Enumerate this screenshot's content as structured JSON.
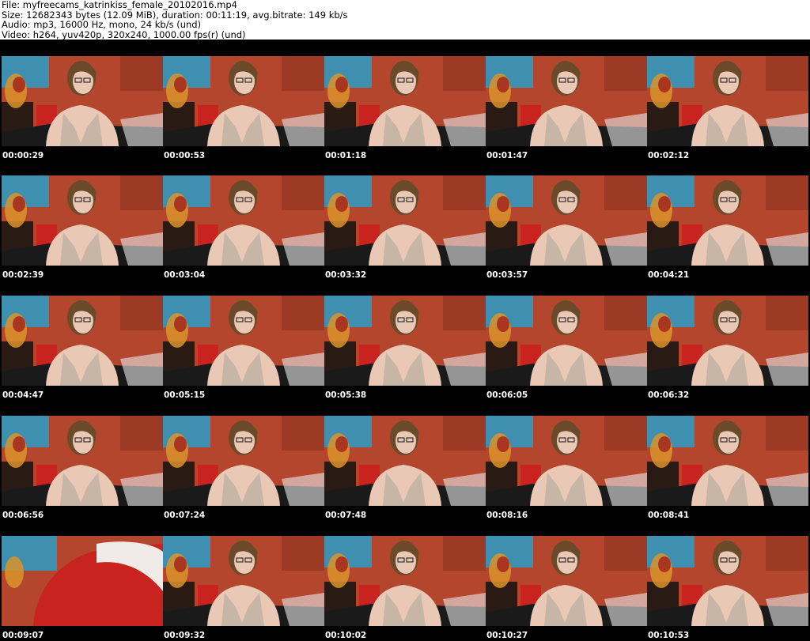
{
  "header": {
    "file_line": "File: myfreecams_katrinkiss_female_20102016.mp4",
    "size_line": "Size: 12682343 bytes (12.09 MiB), duration: 00:11:19, avg.bitrate: 149 kb/s",
    "audio_line": "Audio: mp3, 16000 Hz, mono, 24 kb/s (und)",
    "video_line": "Video: h264, yuv420p, 320x240, 1000.00 fps(r) (und)"
  },
  "thumbnails": [
    {
      "timestamp": "00:00:29",
      "variant": "normal"
    },
    {
      "timestamp": "00:00:53",
      "variant": "normal"
    },
    {
      "timestamp": "00:01:18",
      "variant": "normal"
    },
    {
      "timestamp": "00:01:47",
      "variant": "normal"
    },
    {
      "timestamp": "00:02:12",
      "variant": "normal"
    },
    {
      "timestamp": "00:02:39",
      "variant": "normal"
    },
    {
      "timestamp": "00:03:04",
      "variant": "normal"
    },
    {
      "timestamp": "00:03:32",
      "variant": "normal"
    },
    {
      "timestamp": "00:03:57",
      "variant": "normal"
    },
    {
      "timestamp": "00:04:21",
      "variant": "normal"
    },
    {
      "timestamp": "00:04:47",
      "variant": "normal"
    },
    {
      "timestamp": "00:05:15",
      "variant": "normal"
    },
    {
      "timestamp": "00:05:38",
      "variant": "normal"
    },
    {
      "timestamp": "00:06:05",
      "variant": "normal"
    },
    {
      "timestamp": "00:06:32",
      "variant": "normal"
    },
    {
      "timestamp": "00:06:56",
      "variant": "normal"
    },
    {
      "timestamp": "00:07:24",
      "variant": "normal"
    },
    {
      "timestamp": "00:07:48",
      "variant": "normal"
    },
    {
      "timestamp": "00:08:16",
      "variant": "normal"
    },
    {
      "timestamp": "00:08:41",
      "variant": "normal"
    },
    {
      "timestamp": "00:09:07",
      "variant": "closeup"
    },
    {
      "timestamp": "00:09:32",
      "variant": "normal"
    },
    {
      "timestamp": "00:10:02",
      "variant": "normal"
    },
    {
      "timestamp": "00:10:27",
      "variant": "normal"
    },
    {
      "timestamp": "00:10:53",
      "variant": "normal"
    }
  ],
  "colors": {
    "background_wall": "#b4462e",
    "poster_blue": "#3f8fb0",
    "curtain_red": "#c8231e",
    "top_garment": "#c7b5a6",
    "skin": "#e9c9b6",
    "hair": "#6b4a2a",
    "bedding_dark": "#1a1a1a",
    "frame_border": "#000000",
    "stamp_text": "#ffffff"
  }
}
